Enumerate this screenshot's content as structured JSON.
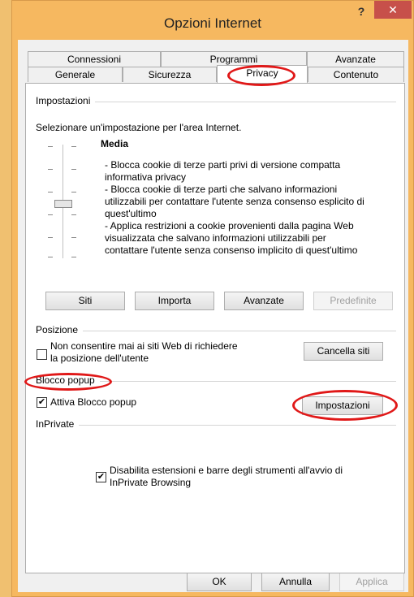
{
  "window": {
    "title": "Opzioni Internet",
    "help_glyph": "?",
    "close_glyph": "✕"
  },
  "tabs": {
    "row1": [
      "Connessioni",
      "Programmi",
      "Avanzate"
    ],
    "row2": [
      "Generale",
      "Sicurezza",
      "Privacy",
      "Contenuto"
    ],
    "selected": "Privacy"
  },
  "settings": {
    "group_label": "Impostazioni",
    "intro": "Selezionare un'impostazione per l'area Internet.",
    "level": "Media",
    "description": [
      "- Blocca cookie di terze parti privi di versione compatta",
      "informativa privacy",
      "- Blocca cookie di terze parti che salvano informazioni",
      "utilizzabili per contattare l'utente senza consenso esplicito di",
      "quest'ultimo",
      "- Applica restrizioni a cookie provenienti dalla pagina Web",
      "visualizzata che salvano informazioni utilizzabili per",
      "contattare l'utente senza consenso implicito di quest'ultimo"
    ],
    "buttons": {
      "sites": "Siti",
      "import": "Importa",
      "advanced": "Avanzate",
      "default": "Predefinite"
    }
  },
  "location": {
    "group_label": "Posizione",
    "checkbox_label_line1": "Non consentire mai ai siti Web di richiedere",
    "checkbox_label_line2": "la posizione dell'utente",
    "checked": false,
    "clear_button": "Cancella siti"
  },
  "popup": {
    "group_label": "Blocco popup",
    "checkbox_label": "Attiva Blocco popup",
    "checked": true,
    "settings_button": "Impostazioni"
  },
  "inprivate": {
    "group_label": "InPrivate",
    "checkbox_label_line1": "Disabilita estensioni e barre degli strumenti all'avvio di",
    "checkbox_label_line2": "InPrivate Browsing",
    "checked": true
  },
  "footer": {
    "ok": "OK",
    "cancel": "Annulla",
    "apply": "Applica"
  },
  "check_glyph": "✔"
}
